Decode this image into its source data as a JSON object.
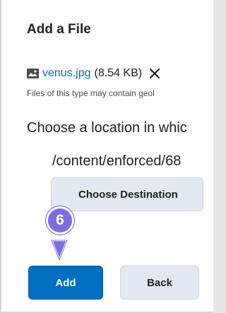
{
  "dialog": {
    "title": "Add a File",
    "file": {
      "icon": "image-file-icon",
      "name": "venus.jpg",
      "size": "(8.54 KB)",
      "remove_icon": "close-icon"
    },
    "warning": "Files of this type may contain geol",
    "choose_location_text": "Choose a location in whic",
    "destination_path": "/content/enforced/68",
    "choose_destination_label": "Choose Destination",
    "add_label": "Add",
    "back_label": "Back"
  },
  "annotation": {
    "step_number": "6",
    "color": "#7b6fe0"
  },
  "colors": {
    "primary": "#006fbf",
    "secondary_button": "#e3e9f1",
    "text": "#202122",
    "link": "#006fbf"
  }
}
